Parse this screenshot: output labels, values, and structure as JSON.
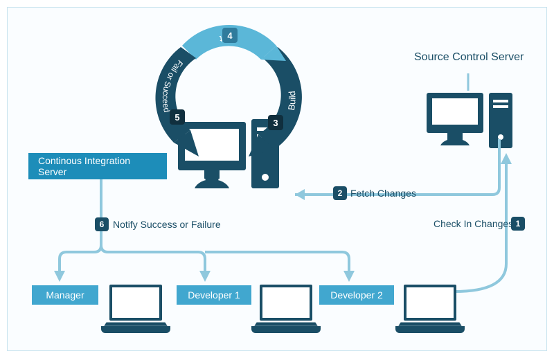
{
  "colors": {
    "dark": "#1a4e66",
    "mid": "#1d8db9",
    "light": "#5bb7d8",
    "pale": "#8fc8dd"
  },
  "ci_server": {
    "label": "Continous Integration Server"
  },
  "source_server": {
    "label": "Source Control Server"
  },
  "steps": {
    "1": {
      "num": "1",
      "label": "Check In Changes"
    },
    "2": {
      "num": "2",
      "label": "Fetch Changes"
    },
    "3": {
      "num": "3",
      "label": "Build"
    },
    "4": {
      "num": "4",
      "label": "Test"
    },
    "5": {
      "num": "5",
      "label": "Fail or Succeed"
    },
    "6": {
      "num": "6",
      "label": "Notify Success or Failure"
    }
  },
  "roles": {
    "manager": "Manager",
    "dev1": "Developer 1",
    "dev2": "Developer 2"
  }
}
